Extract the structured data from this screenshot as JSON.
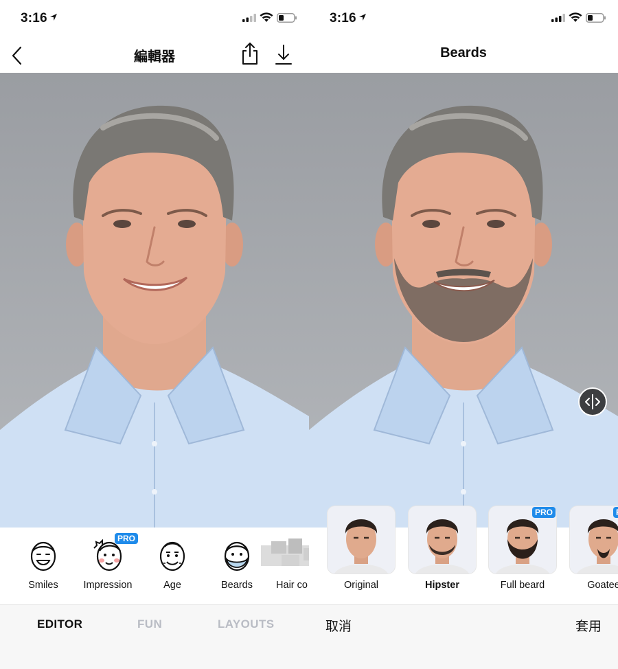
{
  "left": {
    "status": {
      "time": "3:16"
    },
    "nav": {
      "title": "編輯器"
    },
    "tools": [
      {
        "label": "Smiles",
        "icon": "smile-face-icon",
        "pro": false
      },
      {
        "label": "Impression",
        "icon": "impression-face-icon",
        "pro": true
      },
      {
        "label": "Age",
        "icon": "old-face-icon",
        "pro": false
      },
      {
        "label": "Beards",
        "icon": "beard-face-icon",
        "pro": false
      },
      {
        "label": "Hair co",
        "icon": "hair-color-icon",
        "pro": false
      }
    ],
    "pro_badge": "PRO",
    "tabs": [
      {
        "label": "EDITOR",
        "active": true
      },
      {
        "label": "FUN",
        "active": false
      },
      {
        "label": "LAYOUTS",
        "active": false
      }
    ]
  },
  "right": {
    "status": {
      "time": "3:16"
    },
    "nav": {
      "title": "Beards"
    },
    "styles": [
      {
        "label": "Original",
        "selected": false,
        "pro": false
      },
      {
        "label": "Hipster",
        "selected": true,
        "pro": false
      },
      {
        "label": "Full beard",
        "selected": false,
        "pro": true
      },
      {
        "label": "Goatee",
        "selected": false,
        "pro": true
      }
    ],
    "pro_badge": "PRO",
    "actions": {
      "cancel": "取消",
      "apply": "套用"
    }
  },
  "colors": {
    "accent": "#1f8bea",
    "photo_bg": "#9ea1a6",
    "shirt": "#c9dcf2",
    "tab_inactive": "#b9bcc4",
    "bar_bg": "#f7f7f7"
  }
}
